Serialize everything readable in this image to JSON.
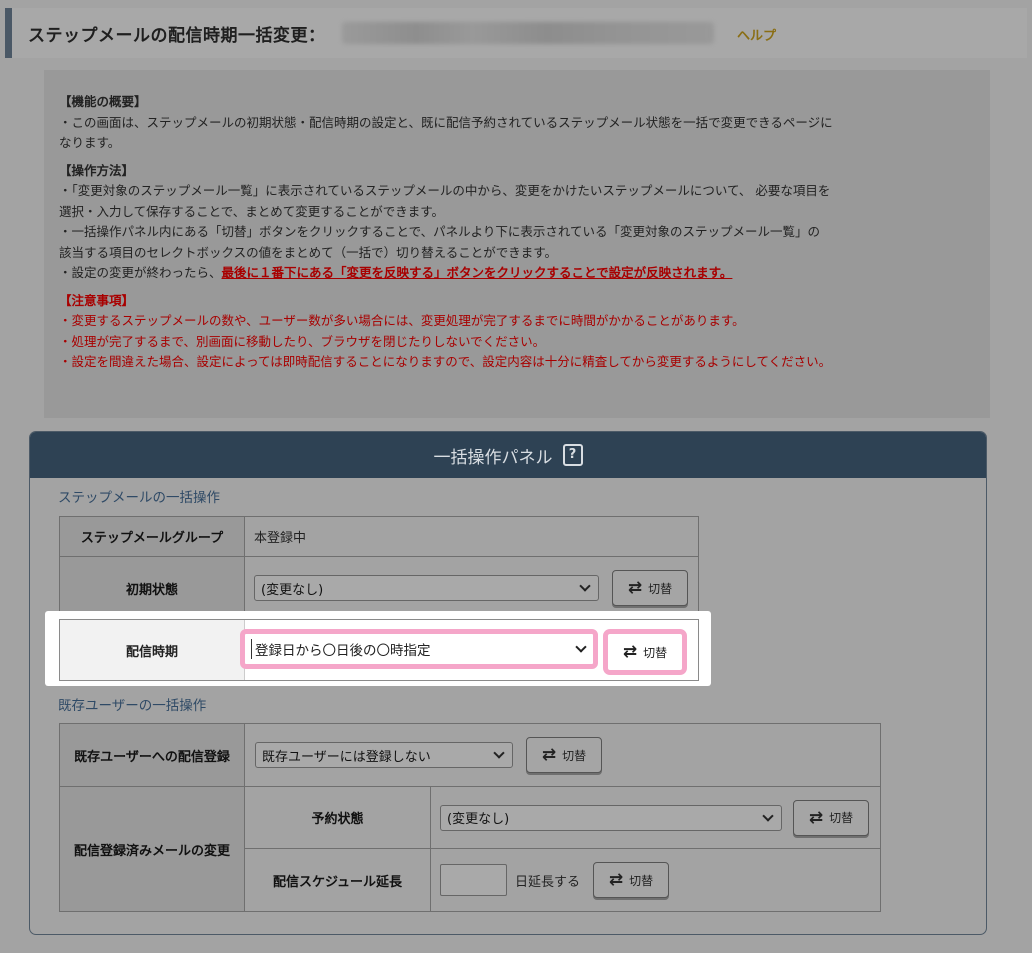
{
  "header": {
    "title": "ステップメールの配信時期一括変更：",
    "help_label": "ヘルプ"
  },
  "info": {
    "overview_title": "【機能の概要】",
    "overview_lines": [
      "・この画面は、ステップメールの初期状態・配信時期の設定と、既に配信予約されているステップメール状態を一括で変更できるページに",
      "なります。"
    ],
    "howto_title": "【操作方法】",
    "howto_lines": [
      "・「変更対象のステップメール一覧」に表示されているステップメールの中から、変更をかけたいステップメールについて、 必要な項目を",
      "選択・入力して保存することで、まとめて変更することができます。",
      "・一括操作パネル内にある「切替」ボタンをクリックすることで、パネルより下に表示されている「変更対象のステップメール一覧」の",
      "該当する項目のセレクトボックスの値をまとめて（一括で）切り替えることができます。"
    ],
    "howto_last_prefix": "・設定の変更が終わったら、",
    "howto_last_emphasis": "最後に１番下にある「変更を反映する」ボタンをクリックすることで設定が反映されます。",
    "caution_title": "【注意事項】",
    "caution_lines": [
      "・変更するステップメールの数や、ユーザー数が多い場合には、変更処理が完了するまでに時間がかかることがあります。",
      "・処理が完了するまで、別画面に移動したり、ブラウザを閉じたりしないでください。",
      "・設定を間違えた場合、設定によっては即時配信することになりますので、設定内容は十分に精査してから変更するようにしてください。"
    ]
  },
  "panel": {
    "title": "一括操作パネル",
    "help_icon_glyph": "?",
    "step_section_label": "ステップメールの一括操作",
    "group_label": "ステップメールグループ",
    "group_value": "本登録中",
    "initial_label": "初期状態",
    "initial_select": "(変更なし)",
    "timing_label": "配信時期",
    "timing_select": "登録日から〇日後の〇時指定",
    "existing_section_label": "既存ユーザーの一括操作",
    "existing_reg_label": "既存ユーザーへの配信登録",
    "existing_reg_select": "既存ユーザーには登録しない",
    "registered_change_label": "配信登録済みメールの変更",
    "reserve_label": "予約状態",
    "reserve_select": "(変更なし)",
    "extend_label": "配信スケジュール延長",
    "extend_value": "",
    "extend_suffix": "日延長する",
    "switch_label": "切替",
    "swap_glyph": "⇄"
  },
  "colors": {
    "panel_header": "#2e4254",
    "highlight": "#f5a6c9",
    "caution_red": "#a80000",
    "section_label": "#2f4a66"
  }
}
